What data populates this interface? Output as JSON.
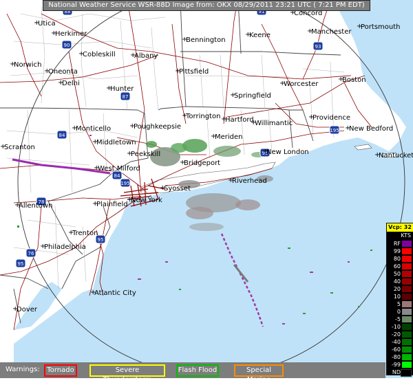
{
  "header": "National Weather Service WSR-88D Image from: OKX 08/29/2011 23:21 UTC ( 7:21 PM EDT)",
  "cities": [
    "Utica",
    "Herkimer",
    "Cobleskill",
    "Albany",
    "Bennington",
    "Keene",
    "Concord",
    "Manchester",
    "Portsmouth",
    "Norwich",
    "Oneonta",
    "Delhi",
    "Hunter",
    "Pittsfield",
    "Worcester",
    "Boston",
    "Springfield",
    "Torrington",
    "Hartford",
    "Willimantic",
    "Providence",
    "New Bedford",
    "Monticello",
    "Poughkeepsie",
    "Middletown",
    "Meriden",
    "New London",
    "Nantucket",
    "Scranton",
    "Peekskill",
    "West Milford",
    "Bridgeport",
    "Riverhead",
    "Syosset",
    "Allentown",
    "Plainfield",
    "New York",
    "Trenton",
    "Philadelphia",
    "Atlantic City",
    "Dover"
  ],
  "shields": [
    "88",
    "90",
    "91",
    "87",
    "93",
    "95",
    "195",
    "84",
    "84",
    "78",
    "95",
    "195",
    "76",
    "95"
  ],
  "legend": {
    "title": "Vcp: 32",
    "units": "KTS",
    "items": [
      {
        "label": "RF",
        "color": "#8000a0"
      },
      {
        "label": "99",
        "color": "#ff0000"
      },
      {
        "label": "80",
        "color": "#f00000"
      },
      {
        "label": "60",
        "color": "#d80000"
      },
      {
        "label": "50",
        "color": "#b40000"
      },
      {
        "label": "40",
        "color": "#960000"
      },
      {
        "label": "20",
        "color": "#780000"
      },
      {
        "label": "10",
        "color": "#5a0000"
      },
      {
        "label": "5",
        "color": "#9c7878"
      },
      {
        "label": "0",
        "color": "#8a8a8a"
      },
      {
        "label": "-5",
        "color": "#6a8a6a"
      },
      {
        "label": "-10",
        "color": "#004000"
      },
      {
        "label": "-20",
        "color": "#005800"
      },
      {
        "label": "-40",
        "color": "#007000"
      },
      {
        "label": "-60",
        "color": "#008c00"
      },
      {
        "label": "-80",
        "color": "#00b400"
      },
      {
        "label": "-99",
        "color": "#00ff00"
      },
      {
        "label": "ND",
        "color": "#000000"
      }
    ]
  },
  "warnings": {
    "label": "Warnings:",
    "items": [
      {
        "label": "Tornado",
        "color": "#ff0000"
      },
      {
        "label": "Severe Thunderstorm",
        "color": "#ffff00"
      },
      {
        "label": "Flash Flood",
        "color": "#00c000"
      },
      {
        "label": "Special Marine",
        "color": "#ff8c00"
      }
    ]
  },
  "colors": {
    "ocean": "#bfe2f8",
    "land": "#ffffff",
    "roads": "#8b0000",
    "borders": "#555555"
  }
}
